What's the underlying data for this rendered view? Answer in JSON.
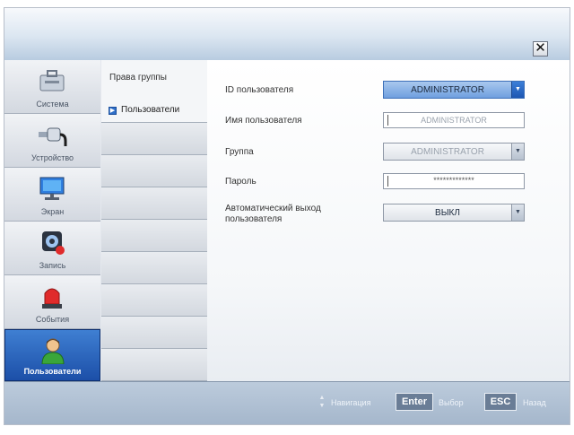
{
  "window": {
    "close_icon": "close-icon"
  },
  "categories": [
    {
      "label": "Система",
      "icon": "toolbox-icon",
      "active": false
    },
    {
      "label": "Устройство",
      "icon": "device-plug-icon",
      "active": false
    },
    {
      "label": "Экран",
      "icon": "monitor-icon",
      "active": false
    },
    {
      "label": "Запись",
      "icon": "record-icon",
      "active": false
    },
    {
      "label": "События",
      "icon": "alarm-light-icon",
      "active": false
    },
    {
      "label": "Пользователи",
      "icon": "user-icon",
      "active": true
    }
  ],
  "submenu": {
    "group_rights": "Права группы",
    "users": "Пользователи"
  },
  "form": {
    "user_id": {
      "label": "ID пользователя",
      "value": "ADMINISTRATOR"
    },
    "user_name": {
      "label": "Имя пользователя",
      "value": "ADMINISTRATOR"
    },
    "group": {
      "label": "Группа",
      "value": "ADMINISTRATOR"
    },
    "password": {
      "label": "Пароль",
      "value": "*************"
    },
    "auto_logout": {
      "label_line1": "Автоматический выход",
      "label_line2": "пользователя",
      "value": "ВЫКЛ"
    }
  },
  "footer": {
    "nav_label": "Навигация",
    "enter_key": "Enter",
    "enter_label": "Выбор",
    "esc_key": "ESC",
    "esc_label": "Назад"
  },
  "colors": {
    "accent": "#1c4fa8",
    "panel": "#e4e8ee"
  }
}
